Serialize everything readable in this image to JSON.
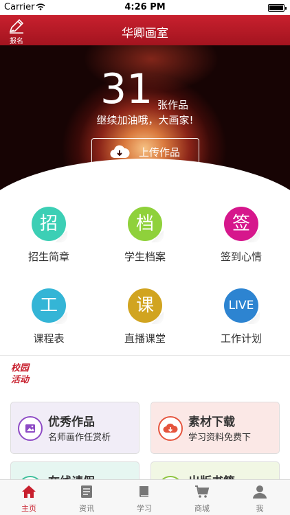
{
  "status_bar": {
    "carrier": "Carrier",
    "time": "4:26 PM"
  },
  "nav": {
    "title": "华卿画室",
    "signup_label": "报名"
  },
  "hero": {
    "count": "31",
    "count_unit": "张作品",
    "message": "继续加油哦，大画家!",
    "upload_label": "上传作品"
  },
  "grid": [
    {
      "glyph": "招",
      "label": "招生简章",
      "color": "#3ccfb5"
    },
    {
      "glyph": "档",
      "label": "学生档案",
      "color": "#8fd13b"
    },
    {
      "glyph": "签",
      "label": "签到心情",
      "color": "#d6178c"
    },
    {
      "glyph": "工",
      "label": "课程表",
      "color": "#34b5d6"
    },
    {
      "glyph": "课",
      "label": "直播课堂",
      "color": "#d1a420"
    },
    {
      "glyph": "LIVE",
      "label": "工作计划",
      "color": "#2d84d1"
    }
  ],
  "section": {
    "title_line1": "校园",
    "title_line2": "活动"
  },
  "cards": [
    {
      "title": "优秀作品",
      "subtitle": "名师画作任赏析",
      "bg": "#f1edf7",
      "accent": "#8e4bc5",
      "icon": "picture-icon"
    },
    {
      "title": "素材下载",
      "subtitle": "学习资料免费下",
      "bg": "#fbe8e6",
      "accent": "#e5553e",
      "icon": "cloud-download-icon"
    },
    {
      "title": "在线请假",
      "subtitle": "",
      "bg": "#e6f6f1",
      "accent": "#3cbf9a",
      "icon": "leave-icon"
    },
    {
      "title": "出版书籍",
      "subtitle": "",
      "bg": "#f1f7e4",
      "accent": "#8cc33b",
      "icon": "book-icon"
    }
  ],
  "tabs": [
    {
      "label": "主页",
      "icon": "home-icon",
      "active": true
    },
    {
      "label": "资讯",
      "icon": "news-icon",
      "active": false
    },
    {
      "label": "学习",
      "icon": "study-icon",
      "active": false
    },
    {
      "label": "商城",
      "icon": "cart-icon",
      "active": false
    },
    {
      "label": "我",
      "icon": "user-icon",
      "active": false
    }
  ],
  "theme": {
    "primary": "#c8202e"
  }
}
